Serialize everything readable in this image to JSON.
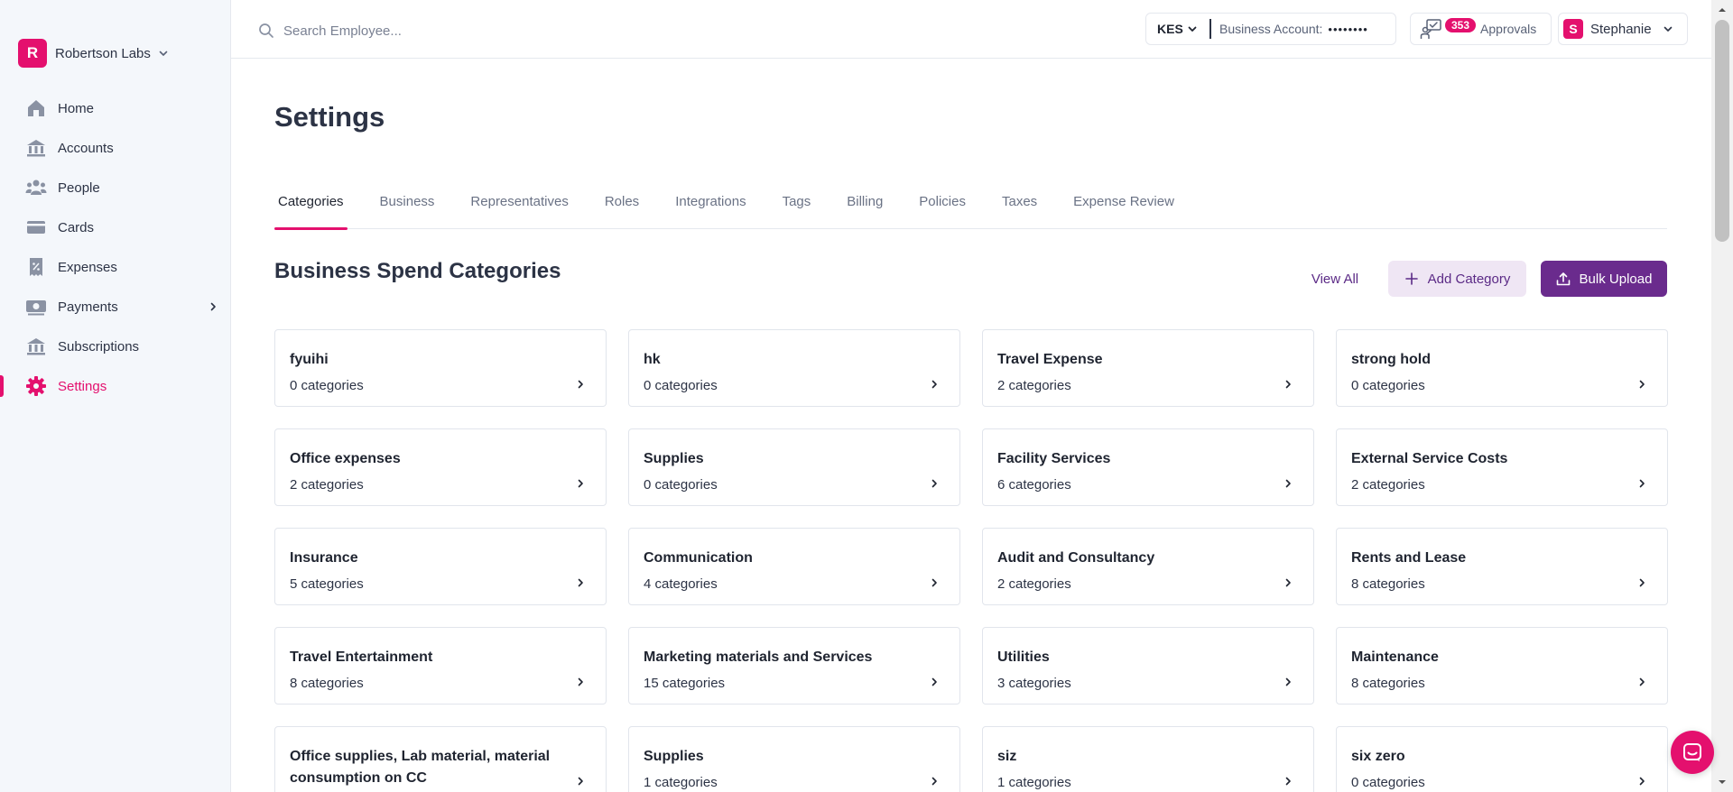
{
  "org": {
    "initial": "R",
    "name": "Robertson Labs"
  },
  "nav": [
    {
      "label": "Home",
      "icon": "home-icon"
    },
    {
      "label": "Accounts",
      "icon": "bank-icon"
    },
    {
      "label": "People",
      "icon": "people-icon"
    },
    {
      "label": "Cards",
      "icon": "card-icon"
    },
    {
      "label": "Expenses",
      "icon": "receipt-icon"
    },
    {
      "label": "Payments",
      "icon": "payments-icon"
    },
    {
      "label": "Subscriptions",
      "icon": "subscriptions-icon"
    },
    {
      "label": "Settings",
      "icon": "gear-icon",
      "active": true
    }
  ],
  "topbar": {
    "search_placeholder": "Search Employee...",
    "currency": "KES",
    "business_account_label": "Business Account:",
    "business_account_mask": "••••••••",
    "approvals_count": "353",
    "approvals_label": "Approvals",
    "user_initial": "S",
    "user_name": "Stephanie"
  },
  "page": {
    "title": "Settings"
  },
  "tabs": [
    "Categories",
    "Business",
    "Representatives",
    "Roles",
    "Integrations",
    "Tags",
    "Billing",
    "Policies",
    "Taxes",
    "Expense Review"
  ],
  "section": {
    "title": "Business Spend Categories",
    "view_all": "View All",
    "add_category": "Add Category",
    "bulk_upload": "Bulk Upload"
  },
  "categories": [
    {
      "name": "fyuihi",
      "count": "0 categories"
    },
    {
      "name": "hk",
      "count": "0 categories"
    },
    {
      "name": "Travel Expense",
      "count": "2 categories"
    },
    {
      "name": "strong hold",
      "count": "0 categories"
    },
    {
      "name": "Office expenses",
      "count": "2 categories"
    },
    {
      "name": "Supplies",
      "count": "0 categories"
    },
    {
      "name": "Facility Services",
      "count": "6 categories"
    },
    {
      "name": "External Service Costs",
      "count": "2 categories"
    },
    {
      "name": "Insurance",
      "count": "5 categories"
    },
    {
      "name": "Communication",
      "count": "4 categories"
    },
    {
      "name": "Audit and Consultancy",
      "count": "2 categories"
    },
    {
      "name": "Rents and Lease",
      "count": "8 categories"
    },
    {
      "name": "Travel Entertainment",
      "count": "8 categories"
    },
    {
      "name": "Marketing materials and Services",
      "count": "15 categories"
    },
    {
      "name": "Utilities",
      "count": "3 categories"
    },
    {
      "name": "Maintenance",
      "count": "8 categories"
    },
    {
      "name": "Office supplies, Lab material, material consumption on CC",
      "count": ""
    },
    {
      "name": "Supplies",
      "count": "1 categories"
    },
    {
      "name": "siz",
      "count": "1 categories"
    },
    {
      "name": "six zero",
      "count": "0 categories"
    }
  ],
  "colors": {
    "accent": "#e4106e",
    "primary_button": "#6a2b8d",
    "secondary_button": "#efe6f4",
    "sidebar_bg": "#f4f7fb"
  }
}
